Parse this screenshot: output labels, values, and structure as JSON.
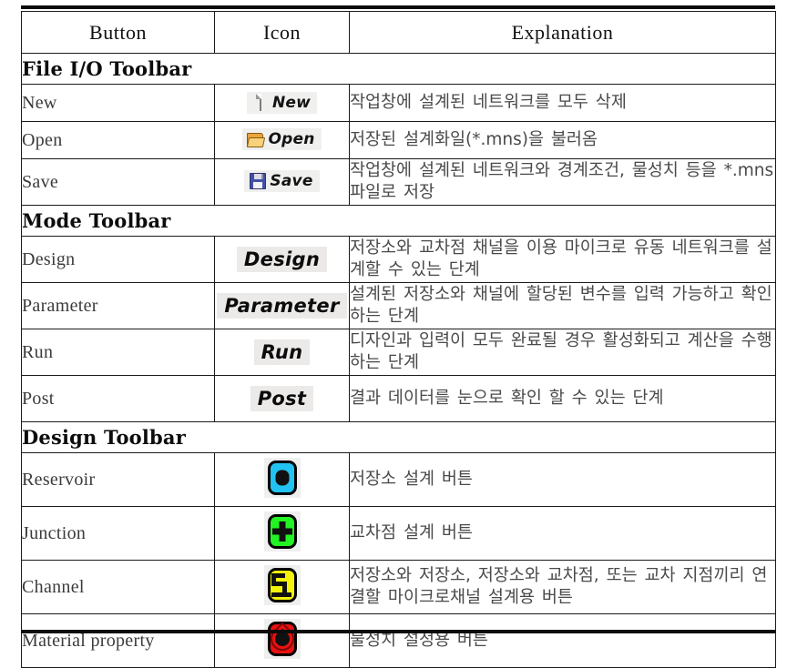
{
  "table": {
    "columns": [
      "Button",
      "Icon",
      "Explanation"
    ],
    "sections": [
      {
        "title": "File I/O Toolbar",
        "rows": [
          {
            "button": "New",
            "icon_label": "New",
            "icon_glyph": "new-document-icon",
            "explanation": "작업창에 설계된 네트워크를 모두 삭제"
          },
          {
            "button": "Open",
            "icon_label": "Open",
            "icon_glyph": "open-folder-icon",
            "explanation": "저장된 설계화일(*.mns)을 불러옴"
          },
          {
            "button": "Save",
            "icon_label": "Save",
            "icon_glyph": "floppy-disk-icon",
            "explanation": "작업창에 설계된 네트워크와 경계조건, 물성치 등을 *.mns 파일로 저장"
          }
        ]
      },
      {
        "title": "Mode Toolbar",
        "rows": [
          {
            "button": "Design",
            "icon_label": "Design",
            "icon_glyph": "design-mode-icon",
            "explanation": "저장소와 교차점 채널을 이용 마이크로 유동 네트워크를 설계할 수 있는 단계"
          },
          {
            "button": "Parameter",
            "icon_label": "Parameter",
            "icon_glyph": "parameter-mode-icon",
            "explanation": "설계된 저장소와 채널에 할당된 변수를 입력 가능하고 확인하는 단계"
          },
          {
            "button": "Run",
            "icon_label": "Run",
            "icon_glyph": "run-mode-icon",
            "explanation": "디자인과 입력이 모두 완료될 경우 활성화되고 계산을 수행하는 단계"
          },
          {
            "button": "Post",
            "icon_label": "Post",
            "icon_glyph": "post-mode-icon",
            "explanation": "결과 데이터를 눈으로 확인 할 수 있는 단계"
          }
        ]
      },
      {
        "title": "Design Toolbar",
        "rows": [
          {
            "button": "Reservoir",
            "icon_label": "",
            "icon_glyph": "reservoir-icon",
            "explanation": "저장소 설계 버튼"
          },
          {
            "button": "Junction",
            "icon_label": "",
            "icon_glyph": "junction-icon",
            "explanation": "교차점 설계 버튼"
          },
          {
            "button": "Channel",
            "icon_label": "",
            "icon_glyph": "channel-icon",
            "explanation": "저장소와 저장소, 저장소와 교차점, 또는 교차 지점끼리 연결할 마이크로채널 설계용 버튼"
          },
          {
            "button": "Material property",
            "icon_label": "",
            "icon_glyph": "material-property-icon",
            "explanation": "물성치 설정용 버튼"
          }
        ]
      }
    ]
  },
  "colors": {
    "reservoir": "#22c3f3",
    "junction": "#23f223",
    "channel": "#f2f20a",
    "material_property": "#ea1111",
    "border": "#1b1b1b",
    "chip_background": "#eceae9"
  }
}
